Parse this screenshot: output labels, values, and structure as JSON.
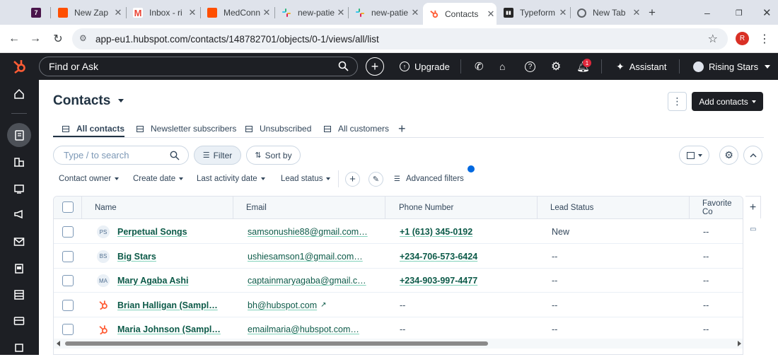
{
  "browser": {
    "tabs": [
      {
        "label": "",
        "icon": "7"
      },
      {
        "label": "New Zap"
      },
      {
        "label": "Inbox - ri"
      },
      {
        "label": "MedConn"
      },
      {
        "label": "new-patie"
      },
      {
        "label": "new-patie"
      },
      {
        "label": "Contacts"
      },
      {
        "label": "Typeform"
      },
      {
        "label": "New Tab"
      }
    ],
    "new_tab": "+",
    "url": "app-eu1.hubspot.com/contacts/148782701/objects/0-1/views/all/list",
    "profile_initial": "R"
  },
  "topbar": {
    "search_placeholder": "Find or Ask",
    "upgrade": "Upgrade",
    "notification_count": "1",
    "assistant": "Assistant",
    "account": "Rising Stars"
  },
  "page": {
    "title": "Contacts",
    "more": "⋮",
    "add_contacts": "Add contacts"
  },
  "views": [
    {
      "label": "All contacts"
    },
    {
      "label": "Newsletter subscribers"
    },
    {
      "label": "Unsubscribed"
    },
    {
      "label": "All customers"
    }
  ],
  "toolbar": {
    "search_placeholder": "Type / to search",
    "filter": "Filter",
    "sort": "Sort by"
  },
  "filters": {
    "contact_owner": "Contact owner",
    "create_date": "Create date",
    "last_activity": "Last activity date",
    "lead_status": "Lead status",
    "advanced": "Advanced filters"
  },
  "table": {
    "columns": [
      "Name",
      "Email",
      "Phone Number",
      "Lead Status",
      "Favorite Co"
    ],
    "rows": [
      {
        "initials": "PS",
        "name": "Perpetual Songs",
        "email": "samsonushie88@gmail.com…",
        "phone": "+1 (613) 345-0192",
        "lead": "New",
        "fav": "--"
      },
      {
        "initials": "BS",
        "name": "Big Stars",
        "email": "ushiesamson1@gmail.com…",
        "phone": "+234-706-573-6424",
        "lead": "--",
        "fav": "--"
      },
      {
        "initials": "MA",
        "name": "Mary Agaba Ashi",
        "email": "captainmaryagaba@gmail.c…",
        "phone": "+234-903-997-4477",
        "lead": "--",
        "fav": "--"
      },
      {
        "initials": "",
        "name": "Brian Halligan (Sampl…",
        "email": "bh@hubspot.com",
        "phone": "--",
        "lead": "--",
        "fav": "--"
      },
      {
        "initials": "",
        "name": "Maria Johnson (Sampl…",
        "email": "emailmaria@hubspot.com…",
        "phone": "--",
        "lead": "--",
        "fav": "--"
      }
    ]
  },
  "colors": {
    "hubspot_orange": "#ff5c35",
    "link": "#0c5a48",
    "dark": "#1d1f24"
  }
}
